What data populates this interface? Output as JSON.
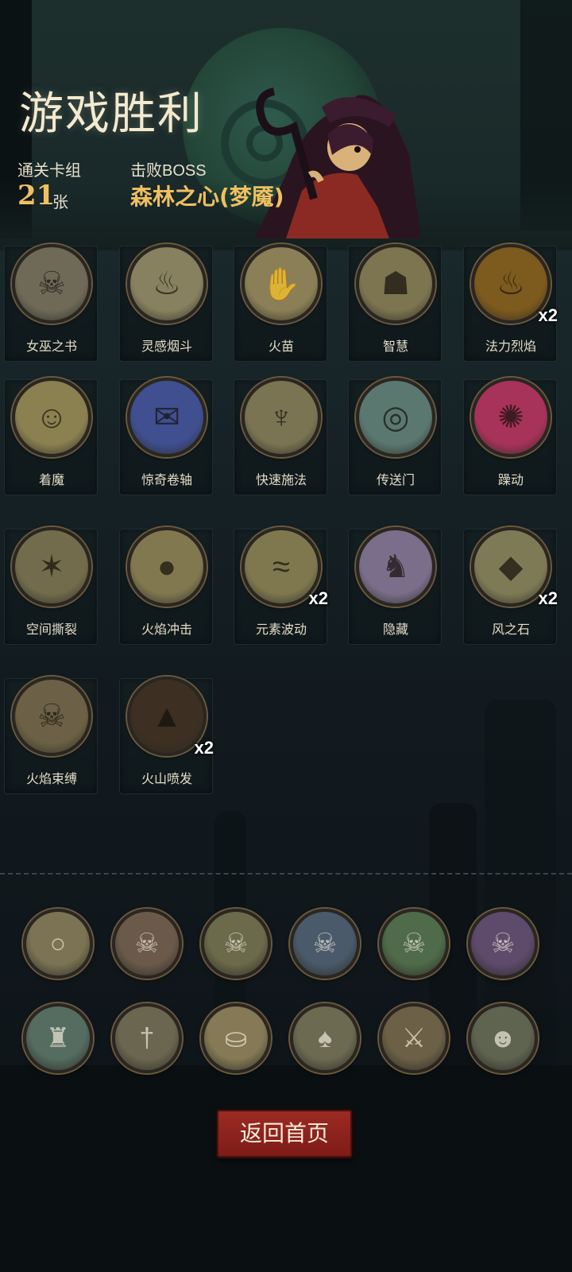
{
  "header": {
    "title": "游戏胜利",
    "deck_label": "通关卡组",
    "deck_count": "21",
    "deck_unit": "张",
    "boss_label": "击败BOSS",
    "boss_name": "森林之心(梦魇)"
  },
  "cards": [
    {
      "name": "女巫之书",
      "icon": "skull-book-icon",
      "bg": "#6f6a57",
      "count": ""
    },
    {
      "name": "灵感烟斗",
      "icon": "smoking-pipe-icon",
      "bg": "#87815f",
      "count": ""
    },
    {
      "name": "火苗",
      "icon": "fire-hand-icon",
      "bg": "#8a7f56",
      "count": ""
    },
    {
      "name": "智慧",
      "icon": "scholar-icon",
      "bg": "#7d7450",
      "count": ""
    },
    {
      "name": "法力烈焰",
      "icon": "flame-goblin-icon",
      "bg": "#7d5a1e",
      "count": "x2"
    },
    {
      "name": "着魔",
      "icon": "possessed-man-icon",
      "bg": "#8a8050",
      "count": ""
    },
    {
      "name": "惊奇卷轴",
      "icon": "scroll-icon",
      "bg": "#3f4f8f",
      "count": ""
    },
    {
      "name": "快速施法",
      "icon": "wizard-icon",
      "bg": "#7a7452",
      "count": ""
    },
    {
      "name": "传送门",
      "icon": "portal-icon",
      "bg": "#5b7870",
      "count": ""
    },
    {
      "name": "躁动",
      "icon": "frenzy-icon",
      "bg": "#a8335a",
      "count": ""
    },
    {
      "name": "空间撕裂",
      "icon": "space-rift-icon",
      "bg": "#726c4c",
      "count": ""
    },
    {
      "name": "火焰冲击",
      "icon": "fireball-icon",
      "bg": "#817850",
      "count": ""
    },
    {
      "name": "元素波动",
      "icon": "elemental-wave-icon",
      "bg": "#7f784f",
      "count": "x2"
    },
    {
      "name": "隐藏",
      "icon": "hiding-imp-icon",
      "bg": "#7b6e8a",
      "count": ""
    },
    {
      "name": "风之石",
      "icon": "wind-stone-icon",
      "bg": "#7f7a56",
      "count": "x2"
    },
    {
      "name": "火焰束缚",
      "icon": "hooded-skeleton-icon",
      "bg": "#6c6146",
      "count": ""
    },
    {
      "name": "火山喷发",
      "icon": "volcano-icon",
      "bg": "#3d2f22",
      "count": "x2"
    }
  ],
  "relics_row1": [
    {
      "icon": "magnifier-icon",
      "bg": "#7b7353"
    },
    {
      "icon": "red-flame-skull-icon",
      "bg": "#6b5a4a"
    },
    {
      "icon": "yellow-flame-skull-icon",
      "bg": "#6b6a4a"
    },
    {
      "icon": "blue-flame-skull-icon",
      "bg": "#4a5a6b"
    },
    {
      "icon": "green-flame-skull-icon",
      "bg": "#4f6b4a"
    },
    {
      "icon": "purple-flame-skull-icon",
      "bg": "#5e4a6b"
    }
  ],
  "relics_row2": [
    {
      "icon": "cloak-icon",
      "bg": "#556c60"
    },
    {
      "icon": "dagger-icon",
      "bg": "#6b6650"
    },
    {
      "icon": "gold-coins-icon",
      "bg": "#857a55"
    },
    {
      "icon": "playing-cards-icon",
      "bg": "#6d6a52"
    },
    {
      "icon": "warrior-icon",
      "bg": "#6c6046"
    },
    {
      "icon": "ogre-ghost-icon",
      "bg": "#5f6450"
    }
  ],
  "footer": {
    "home_button": "返回首页"
  },
  "colors": {
    "gold": "#f0c060",
    "button_red": "#8e2420"
  }
}
